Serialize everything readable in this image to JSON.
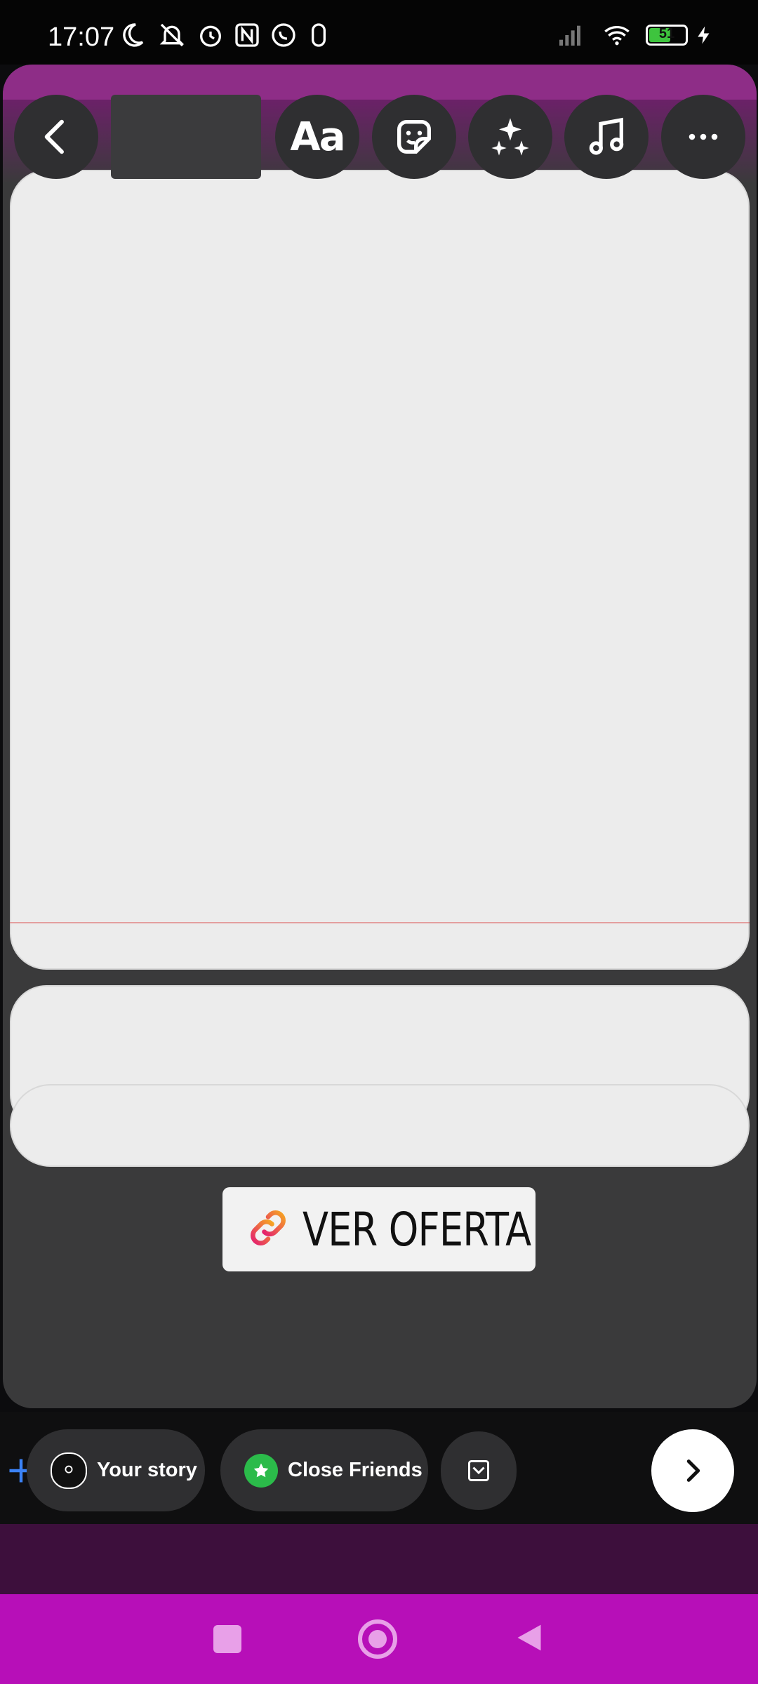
{
  "status_bar": {
    "time": "17:07",
    "icons": [
      "moon-icon",
      "bell-off-icon",
      "alarm-icon",
      "nfc-icon",
      "whatsapp-icon",
      "sim-icon",
      "signal-icon",
      "wifi-icon",
      "battery-icon",
      "charging-icon"
    ],
    "battery_level": "51"
  },
  "toolbar": {
    "back": "back-icon",
    "text_tool_label": "Aa",
    "sticker": "sticker-icon",
    "effects": "sparkles-icon",
    "music": "music-icon",
    "more": "more-icon"
  },
  "link_sticker": {
    "label": "VER OFERTA",
    "icon": "link-icon"
  },
  "share_bar": {
    "your_story_label": "Your story",
    "close_friends_label": "Close Friends",
    "add_icon": "plus-icon",
    "next_icon": "chevron-right-icon"
  },
  "nav_bar": {
    "buttons": [
      "recents-square-icon",
      "home-circle-icon",
      "back-triangle-icon"
    ]
  },
  "colors": {
    "accent_green": "#2bbb4a",
    "nav_magenta": "#b70fb8",
    "canvas_gray": "#3a3a3b"
  }
}
